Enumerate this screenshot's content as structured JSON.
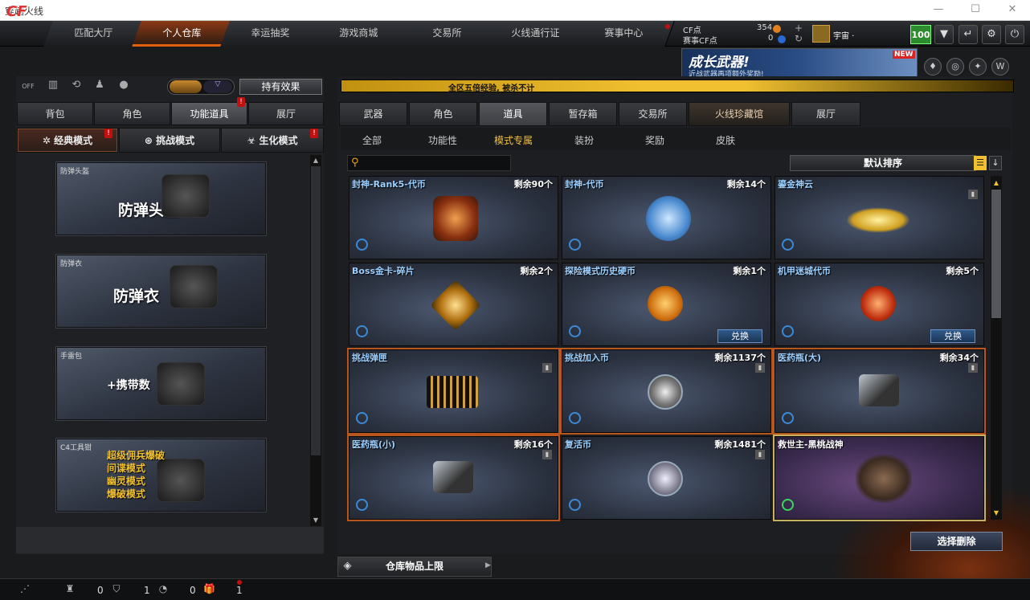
{
  "window": {
    "title": "穿越火线",
    "minimize": "—",
    "maximize": "☐",
    "close": "✕"
  },
  "nav": {
    "logo": "CF",
    "tabs": [
      "匹配大厅",
      "个人仓库",
      "幸运抽奖",
      "游戏商城",
      "交易所",
      "火线通行证",
      "赛事中心"
    ],
    "active_tab": "个人仓库"
  },
  "currency": {
    "cf_label": "CF点",
    "cf_value": "354",
    "match_label": "赛事CF点",
    "match_value": "0",
    "user_name": "宇宙 ·",
    "level": "100"
  },
  "banner": {
    "title": "成长武器!",
    "subtitle": "近战武器再项额外奖励!",
    "new_badge": "NEW"
  },
  "left": {
    "toggle_off_label": "OFF",
    "effect_button": "持有效果",
    "tabs": [
      "背包",
      "角色",
      "功能道具",
      "展厅"
    ],
    "active_tab": "功能道具",
    "modes": [
      "经典模式",
      "挑战模式",
      "生化模式"
    ],
    "mode_badge": "!",
    "items": [
      {
        "label": "防弹头盔",
        "big": "防弹头盔"
      },
      {
        "label": "防弹衣",
        "big": "防弹衣"
      },
      {
        "label": "手雷包",
        "big": "+携带数"
      },
      {
        "label": "C4工具钳",
        "modes": [
          "超级佣兵爆破",
          "间谍模式",
          "幽灵模式",
          "爆破模式"
        ]
      }
    ]
  },
  "right": {
    "ticker": "全区五倍经验, 被杀不计",
    "tabs": [
      "武器",
      "角色",
      "道具",
      "暂存箱",
      "交易所",
      "火线珍藏馆",
      "展厅"
    ],
    "active_tab": "道具",
    "subtabs": [
      "全部",
      "功能性",
      "模式专属",
      "装扮",
      "奖励",
      "皮肤"
    ],
    "active_subtab": "模式专属",
    "search_placeholder": "",
    "sort_label": "默认排序",
    "items": [
      {
        "name": "封神-Rank5-代币",
        "count": "剩余90个"
      },
      {
        "name": "封神-代币",
        "count": "剩余14个"
      },
      {
        "name": "鎏金神云",
        "count": ""
      },
      {
        "name": "Boss金卡-碎片",
        "count": "剩余2个"
      },
      {
        "name": "探险模式历史硬币",
        "count": "剩余1个",
        "action": "兑换"
      },
      {
        "name": "机甲迷城代币",
        "count": "剩余5个",
        "action": "兑换"
      },
      {
        "name": "挑战弹匣",
        "count": ""
      },
      {
        "name": "挑战加入币",
        "count": "剩余1137个"
      },
      {
        "name": "医药瓶(大)",
        "count": "剩余34个"
      },
      {
        "name": "医药瓶(小)",
        "count": "剩余16个"
      },
      {
        "name": "复活币",
        "count": "剩余1481个"
      },
      {
        "name": "救世主-黑桃战神",
        "count": ""
      }
    ],
    "select_delete": "选择删除",
    "warehouse_limit": "仓库物品上限"
  },
  "status": {
    "count1": "0",
    "count2": "1",
    "count3": "0",
    "count4": "1"
  },
  "colors": {
    "accent": "#f0c030",
    "orange": "#e0600f",
    "danger": "#c01010"
  }
}
